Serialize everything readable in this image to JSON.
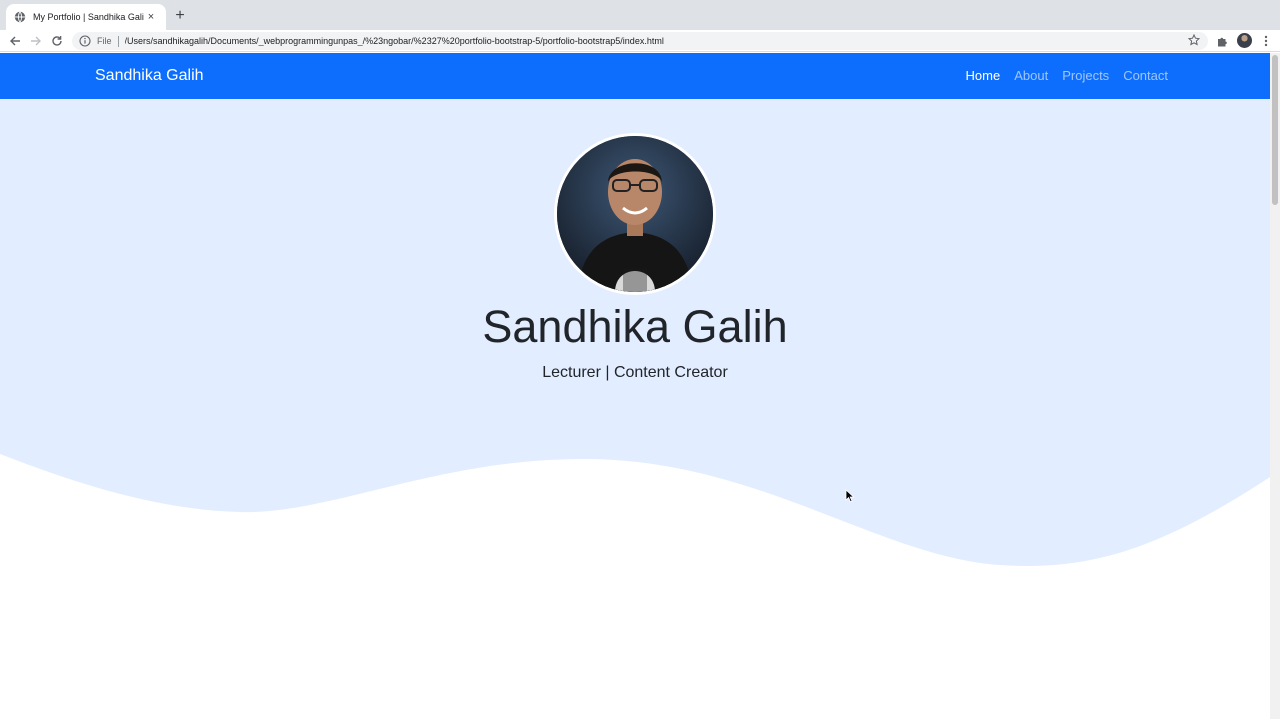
{
  "browser": {
    "tab_title": "My Portfolio | Sandhika Galih",
    "tab_close": "×",
    "new_tab": "+",
    "omnibox_scheme": "File",
    "url": "/Users/sandhikagalih/Documents/_webprogrammingunpas_/%23ngobar/%2327%20portfolio-bootstrap-5/portfolio-bootstrap5/index.html"
  },
  "navbar": {
    "brand": "Sandhika Galih",
    "links": [
      {
        "label": "Home",
        "active": true
      },
      {
        "label": "About",
        "active": false
      },
      {
        "label": "Projects",
        "active": false
      },
      {
        "label": "Contact",
        "active": false
      }
    ],
    "color": "#0d6efd"
  },
  "hero": {
    "name": "Sandhika Galih",
    "tagline": "Lecturer | Content Creator",
    "background_color": "#e2edff"
  }
}
